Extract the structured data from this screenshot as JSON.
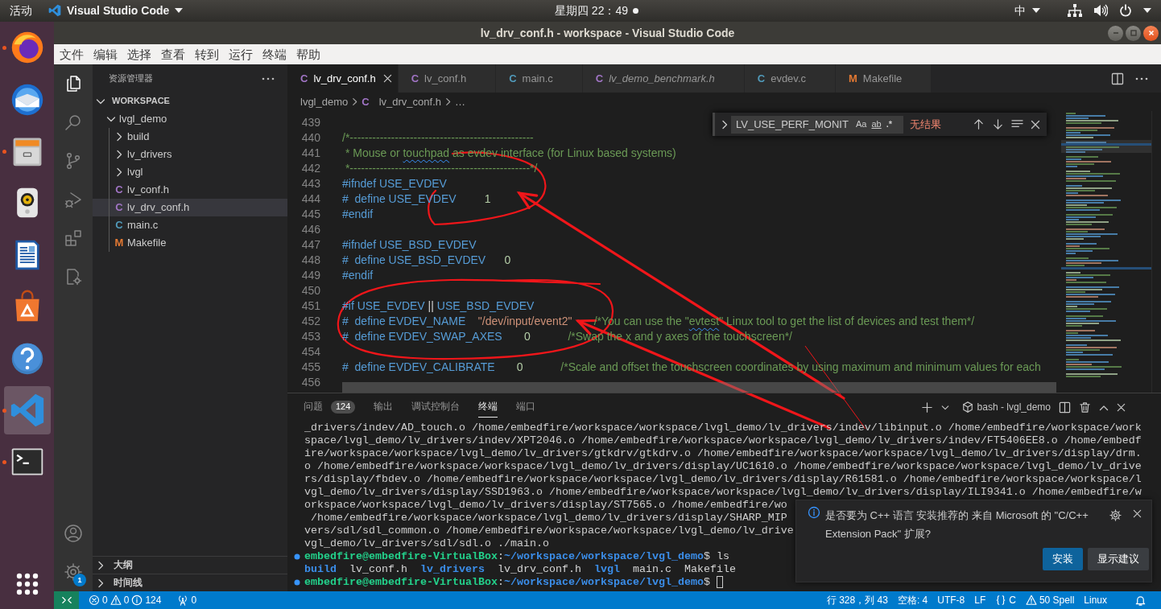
{
  "top_bar": {
    "activities": "活动",
    "app_menu": "Visual Studio Code",
    "clock": "星期四 22：49",
    "input_method": "中"
  },
  "dock": [
    {
      "kind": "browser",
      "running": true,
      "selected": false
    },
    {
      "kind": "mail",
      "running": false,
      "selected": false
    },
    {
      "kind": "files",
      "running": true,
      "selected": false
    },
    {
      "kind": "music",
      "running": false,
      "selected": false
    },
    {
      "kind": "writer",
      "running": false,
      "selected": false
    },
    {
      "kind": "software",
      "running": false,
      "selected": false
    },
    {
      "kind": "help",
      "running": false,
      "selected": false
    },
    {
      "kind": "code",
      "running": true,
      "selected": true
    },
    {
      "kind": "terminal",
      "running": true,
      "selected": false
    }
  ],
  "window": {
    "title": "lv_drv_conf.h - workspace - Visual Studio Code"
  },
  "menu": [
    "文件",
    "编辑",
    "选择",
    "查看",
    "转到",
    "运行",
    "终端",
    "帮助"
  ],
  "activity_bar": [
    {
      "kind": "explorer",
      "selected": true
    },
    {
      "kind": "search",
      "selected": false
    },
    {
      "kind": "source_control",
      "selected": false
    },
    {
      "kind": "run_debug",
      "selected": false
    },
    {
      "kind": "extensions",
      "selected": false
    },
    {
      "kind": "remote",
      "selected": false
    },
    {
      "kind": "accounts",
      "selected": false
    },
    {
      "kind": "manage",
      "selected": false,
      "badge": "1"
    }
  ],
  "sidebar": {
    "title": "资源管理器",
    "section": "WORKSPACE",
    "section_expanded": true,
    "tree": [
      {
        "label": "lvgl_demo",
        "kind": "folder",
        "expanded": true,
        "selected": false,
        "children": [
          {
            "label": "build",
            "kind": "folder",
            "expanded": false,
            "selected": false
          },
          {
            "label": "lv_drivers",
            "kind": "folder",
            "expanded": false,
            "selected": false
          },
          {
            "label": "lvgl",
            "kind": "folder",
            "expanded": false,
            "selected": false
          },
          {
            "label": "lv_conf.h",
            "kind": "h",
            "icon": "C",
            "selected": false
          },
          {
            "label": "lv_drv_conf.h",
            "kind": "h",
            "icon": "C",
            "selected": true
          },
          {
            "label": "main.c",
            "kind": "c",
            "icon": "C",
            "selected": false
          },
          {
            "label": "Makefile",
            "kind": "makefile",
            "icon": "M",
            "selected": false
          }
        ]
      }
    ],
    "panes": [
      {
        "label": "大纲",
        "expanded": false
      },
      {
        "label": "时间线",
        "expanded": false
      }
    ]
  },
  "tabs": [
    {
      "label": "lv_drv_conf.h",
      "icon": "C",
      "kind": "h",
      "selected": true,
      "preview": false
    },
    {
      "label": "lv_conf.h",
      "icon": "C",
      "kind": "h",
      "selected": false,
      "preview": false
    },
    {
      "label": "main.c",
      "icon": "C",
      "kind": "c",
      "selected": false,
      "preview": false
    },
    {
      "label": "lv_demo_benchmark.h",
      "icon": "C",
      "kind": "h",
      "selected": false,
      "preview": true
    },
    {
      "label": "evdev.c",
      "icon": "C",
      "kind": "c",
      "selected": false,
      "preview": false
    },
    {
      "label": "Makefile",
      "icon": "M",
      "kind": "makefile",
      "selected": false,
      "preview": false
    }
  ],
  "breadcrumbs": [
    {
      "label": "lvgl_demo"
    },
    {
      "label": "lv_drv_conf.h",
      "icon": "C",
      "kind": "h"
    },
    {
      "label": "…"
    }
  ],
  "find": {
    "query": "LV_USE_PERF_MONIT",
    "options": [
      {
        "label": "Aa",
        "kind": "case"
      },
      {
        "label": "ab",
        "kind": "word"
      },
      {
        "label": ".*",
        "kind": "regex"
      }
    ],
    "result": "无结果"
  },
  "code": [
    {
      "number": "439"
    },
    {
      "number": "440",
      "tokens": [
        {
          "kind": "comment",
          "text": "/*-------------------------------------------------",
          "misspelled": false
        }
      ]
    },
    {
      "number": "441",
      "tokens": [
        {
          "kind": "comment",
          "text": " * Mouse or ",
          "misspelled": false
        },
        {
          "kind": "comment",
          "text": "touchpad",
          "misspelled": true
        },
        {
          "kind": "comment",
          "text": " as evdev interface (for Linux based systems)",
          "misspelled": false
        }
      ]
    },
    {
      "number": "442",
      "tokens": [
        {
          "kind": "comment",
          "text": " *------------------------------------------------*/",
          "misspelled": false
        }
      ]
    },
    {
      "number": "443",
      "tokens": [
        {
          "kind": "keyword",
          "text": "#ifndef USE_EVDEV"
        }
      ]
    },
    {
      "number": "444",
      "tokens": [
        {
          "kind": "keyword",
          "text": "#  define USE_EVDEV"
        },
        {
          "kind": "number",
          "text": "         1"
        }
      ]
    },
    {
      "number": "445",
      "tokens": [
        {
          "kind": "keyword",
          "text": "#endif"
        }
      ]
    },
    {
      "number": "446"
    },
    {
      "number": "447",
      "tokens": [
        {
          "kind": "keyword",
          "text": "#ifndef USE_BSD_EVDEV"
        }
      ]
    },
    {
      "number": "448",
      "tokens": [
        {
          "kind": "keyword",
          "text": "#  define USE_BSD_EVDEV"
        },
        {
          "kind": "number",
          "text": "      0"
        }
      ]
    },
    {
      "number": "449",
      "tokens": [
        {
          "kind": "keyword",
          "text": "#endif"
        }
      ]
    },
    {
      "number": "450"
    },
    {
      "number": "451",
      "tokens": [
        {
          "kind": "keyword",
          "text": "#if USE_EVDEV "
        },
        {
          "kind": "plain",
          "text": "||"
        },
        {
          "kind": "keyword",
          "text": " USE_BSD_EVDEV"
        }
      ]
    },
    {
      "number": "452",
      "tokens": [
        {
          "kind": "keyword",
          "text": "#  define EVDEV_NAME"
        },
        {
          "kind": "string",
          "text": "    \"/dev/input/event2\""
        },
        {
          "kind": "comment",
          "text": "       /*You can use the \"",
          "misspelled": false
        },
        {
          "kind": "comment",
          "text": "evtest",
          "misspelled": true
        },
        {
          "kind": "comment",
          "text": "\" Linux tool to get the list of devices and test them*/",
          "misspelled": false
        }
      ]
    },
    {
      "number": "453",
      "tokens": [
        {
          "kind": "keyword",
          "text": "#  define EVDEV_SWAP_AXES"
        },
        {
          "kind": "number",
          "text": "       0"
        },
        {
          "kind": "comment",
          "text": "            /*Swap the x and y axes of the touchscreen*/",
          "misspelled": false
        }
      ]
    },
    {
      "number": "454"
    },
    {
      "number": "455",
      "tokens": [
        {
          "kind": "keyword",
          "text": "#  define EVDEV_CALIBRATE"
        },
        {
          "kind": "number",
          "text": "       0"
        },
        {
          "kind": "comment",
          "text": "            /*Scale and offset the touchscreen coordinates by using maximum and minimum values for each",
          "misspelled": false
        }
      ]
    },
    {
      "number": "456"
    }
  ],
  "panel": {
    "tabs": [
      {
        "label": "问题",
        "badge": "124",
        "selected": false
      },
      {
        "label": "输出",
        "selected": false
      },
      {
        "label": "调试控制台",
        "selected": false
      },
      {
        "label": "终端",
        "selected": true
      },
      {
        "label": "端口",
        "selected": false
      }
    ],
    "terminal_title": "bash - lvgl_demo",
    "terminal": [
      {
        "kind": "output",
        "text": "_drivers/indev/AD_touch.o /home/embedfire/workspace/workspace/lvgl_demo/lv_drivers/indev/libinput.o /home/embedfire/workspace/work"
      },
      {
        "kind": "output",
        "text": "space/lvgl_demo/lv_drivers/indev/XPT2046.o /home/embedfire/workspace/workspace/lvgl_demo/lv_drivers/indev/FT5406EE8.o /home/embedf"
      },
      {
        "kind": "output",
        "text": "ire/workspace/workspace/lvgl_demo/lv_drivers/gtkdrv/gtkdrv.o /home/embedfire/workspace/workspace/lvgl_demo/lv_drivers/display/drm."
      },
      {
        "kind": "output",
        "text": "o /home/embedfire/workspace/workspace/lvgl_demo/lv_drivers/display/UC1610.o /home/embedfire/workspace/workspace/lvgl_demo/lv_drive"
      },
      {
        "kind": "output",
        "text": "rs/display/fbdev.o /home/embedfire/workspace/workspace/lvgl_demo/lv_drivers/display/R61581.o /home/embedfire/workspace/workspace/l"
      },
      {
        "kind": "output",
        "text": "vgl_demo/lv_drivers/display/SSD1963.o /home/embedfire/workspace/workspace/lvgl_demo/lv_drivers/display/ILI9341.o /home/embedfire/w"
      },
      {
        "kind": "output",
        "text": "orkspace/workspace/lvgl_demo/lv_drivers/display/ST7565.o /home/embedfire/wo"
      },
      {
        "kind": "output",
        "text": " /home/embedfire/workspace/workspace/lvgl_demo/lv_drivers/display/SHARP_MIP"
      },
      {
        "kind": "output",
        "text": "vers/sdl/sdl_common.o /home/embedfire/workspace/workspace/lvgl_demo/lv_drive"
      },
      {
        "kind": "output",
        "text": "vgl_demo/lv_drivers/sdl/sdl.o ./main.o"
      },
      {
        "kind": "prompt",
        "decoration": true,
        "cursor": false,
        "tokens": [
          {
            "kind": "user",
            "text": "embedfire@embedfire-VirtualBox"
          },
          {
            "kind": "plain",
            "text": ":"
          },
          {
            "kind": "path",
            "text": "~/workspace/workspace/lvgl_demo"
          },
          {
            "kind": "plain",
            "text": "$ ls"
          }
        ]
      },
      {
        "kind": "listing",
        "tokens": [
          {
            "kind": "dir",
            "text": "build"
          },
          {
            "kind": "plain",
            "text": "  lv_conf.h  "
          },
          {
            "kind": "dir",
            "text": "lv_drivers"
          },
          {
            "kind": "plain",
            "text": "  lv_drv_conf.h  "
          },
          {
            "kind": "dir",
            "text": "lvgl"
          },
          {
            "kind": "plain",
            "text": "  main.c  Makefile"
          }
        ]
      },
      {
        "kind": "prompt",
        "decoration": true,
        "cursor": true,
        "tokens": [
          {
            "kind": "user",
            "text": "embedfire@embedfire-VirtualBox"
          },
          {
            "kind": "plain",
            "text": ":"
          },
          {
            "kind": "path",
            "text": "~/workspace/workspace/lvgl_demo"
          },
          {
            "kind": "plain",
            "text": "$ "
          }
        ]
      }
    ]
  },
  "notification": {
    "message": "是否要为 C++ 语言 安装推荐的 来自 Microsoft 的 \"C/C++ Extension Pack\" 扩展?",
    "buttons": [
      {
        "label": "安装",
        "kind": "primary"
      },
      {
        "label": "显示建议",
        "kind": "secondary"
      }
    ]
  },
  "status_bar": {
    "problems": {
      "errors": "0",
      "warnings": "0",
      "infos": "124"
    },
    "ports": "0",
    "items": [
      {
        "kind": "text",
        "label": "行 328，列 43"
      },
      {
        "kind": "text",
        "label": "空格: 4"
      },
      {
        "kind": "text",
        "label": "UTF-8"
      },
      {
        "kind": "text",
        "label": "LF"
      },
      {
        "kind": "language",
        "label": "C"
      },
      {
        "kind": "spell",
        "label": "50 Spell"
      },
      {
        "kind": "text",
        "label": "Linux"
      }
    ]
  },
  "annotations": [
    {
      "kind": "loop"
    },
    {
      "kind": "loop"
    },
    {
      "kind": "arrow"
    },
    {
      "kind": "arrow"
    },
    {
      "kind": "stroke"
    }
  ]
}
